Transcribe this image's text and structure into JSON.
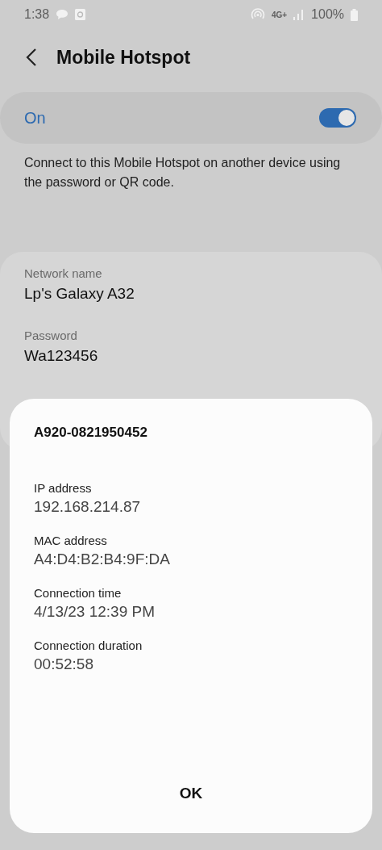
{
  "status_bar": {
    "time": "1:38",
    "network": "4G+",
    "battery": "100%"
  },
  "header": {
    "title": "Mobile Hotspot"
  },
  "master_switch": {
    "label": "On",
    "on": true
  },
  "description": "Connect to this Mobile Hotspot on another device using the password or QR code.",
  "settings": [
    {
      "label": "Network name",
      "value": "Lp's Galaxy A32"
    },
    {
      "label": "Password",
      "value": "Wa123456"
    }
  ],
  "dialog": {
    "title": "A920-0821950452",
    "fields": [
      {
        "label": "IP address",
        "value": "192.168.214.87"
      },
      {
        "label": "MAC address",
        "value": "A4:D4:B2:B4:9F:DA"
      },
      {
        "label": "Connection time",
        "value": "4/13/23 12:39 PM"
      },
      {
        "label": "Connection duration",
        "value": "00:52:58"
      }
    ],
    "button": "OK"
  }
}
